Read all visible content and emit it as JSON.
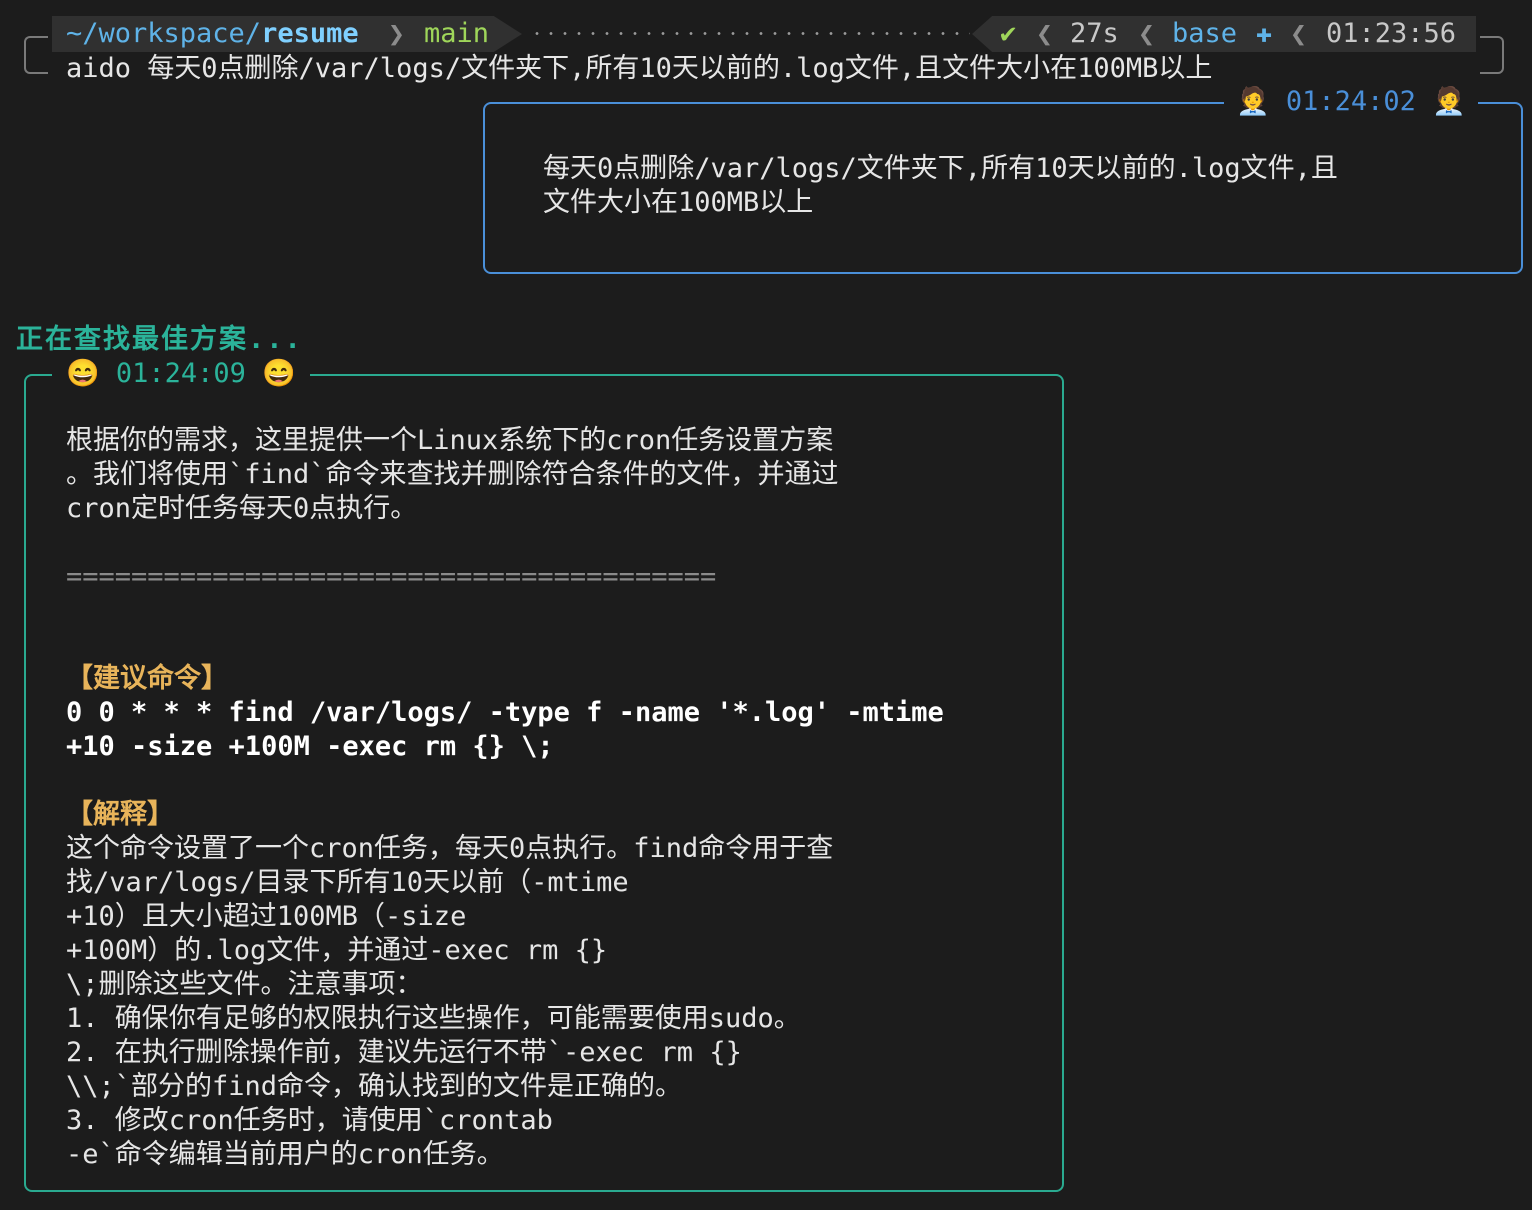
{
  "prompt": {
    "path_prefix": "~/workspace/",
    "path_current": "resume",
    "branch": "main",
    "status_icon": "✔",
    "duration": "27s",
    "env": "base",
    "env_icon": "✚",
    "time": "01:23:56",
    "command": "aido 每天0点删除/var/logs/文件夹下,所有10天以前的.log文件,且文件大小在100MB以上"
  },
  "user_message": {
    "label": "🧑‍💼 01:24:02 🧑‍💼",
    "text": "每天0点删除/var/logs/文件夹下,所有10天以前的.log文件,且\n文件大小在100MB以上"
  },
  "status_text": "正在查找最佳方案...",
  "assistant_message": {
    "label": "😄 01:24:09 😄",
    "intro": "根据你的需求，这里提供一个Linux系统下的cron任务设置方案\n。我们将使用`find`命令来查找并删除符合条件的文件，并通过\ncron定时任务每天0点执行。",
    "separator": "========================================",
    "command_heading": "【建议命令】",
    "command": "0 0 * * * find /var/logs/ -type f -name '*.log' -mtime\n+10 -size +100M -exec rm {} \\;",
    "explain_heading": "【解释】",
    "explain": "这个命令设置了一个cron任务，每天0点执行。find命令用于查\n找/var/logs/目录下所有10天以前（-mtime\n+10）且大小超过100MB（-size\n+100M）的.log文件，并通过-exec rm {}\n\\;删除这些文件。注意事项：\n1. 确保你有足够的权限执行这些操作，可能需要使用sudo。\n2. 在执行删除操作前，建议先运行不带`-exec rm {}\n\\\\;`部分的find命令，确认找到的文件是正确的。\n3. 修改cron任务时，请使用`crontab\n-e`命令编辑当前用户的cron任务。"
  },
  "colors": {
    "background": "#1c1c1c",
    "user_border": "#4a8fd8",
    "assistant_border": "#2aaa90",
    "heading": "#e8b45a",
    "branch": "#9fd65a"
  }
}
